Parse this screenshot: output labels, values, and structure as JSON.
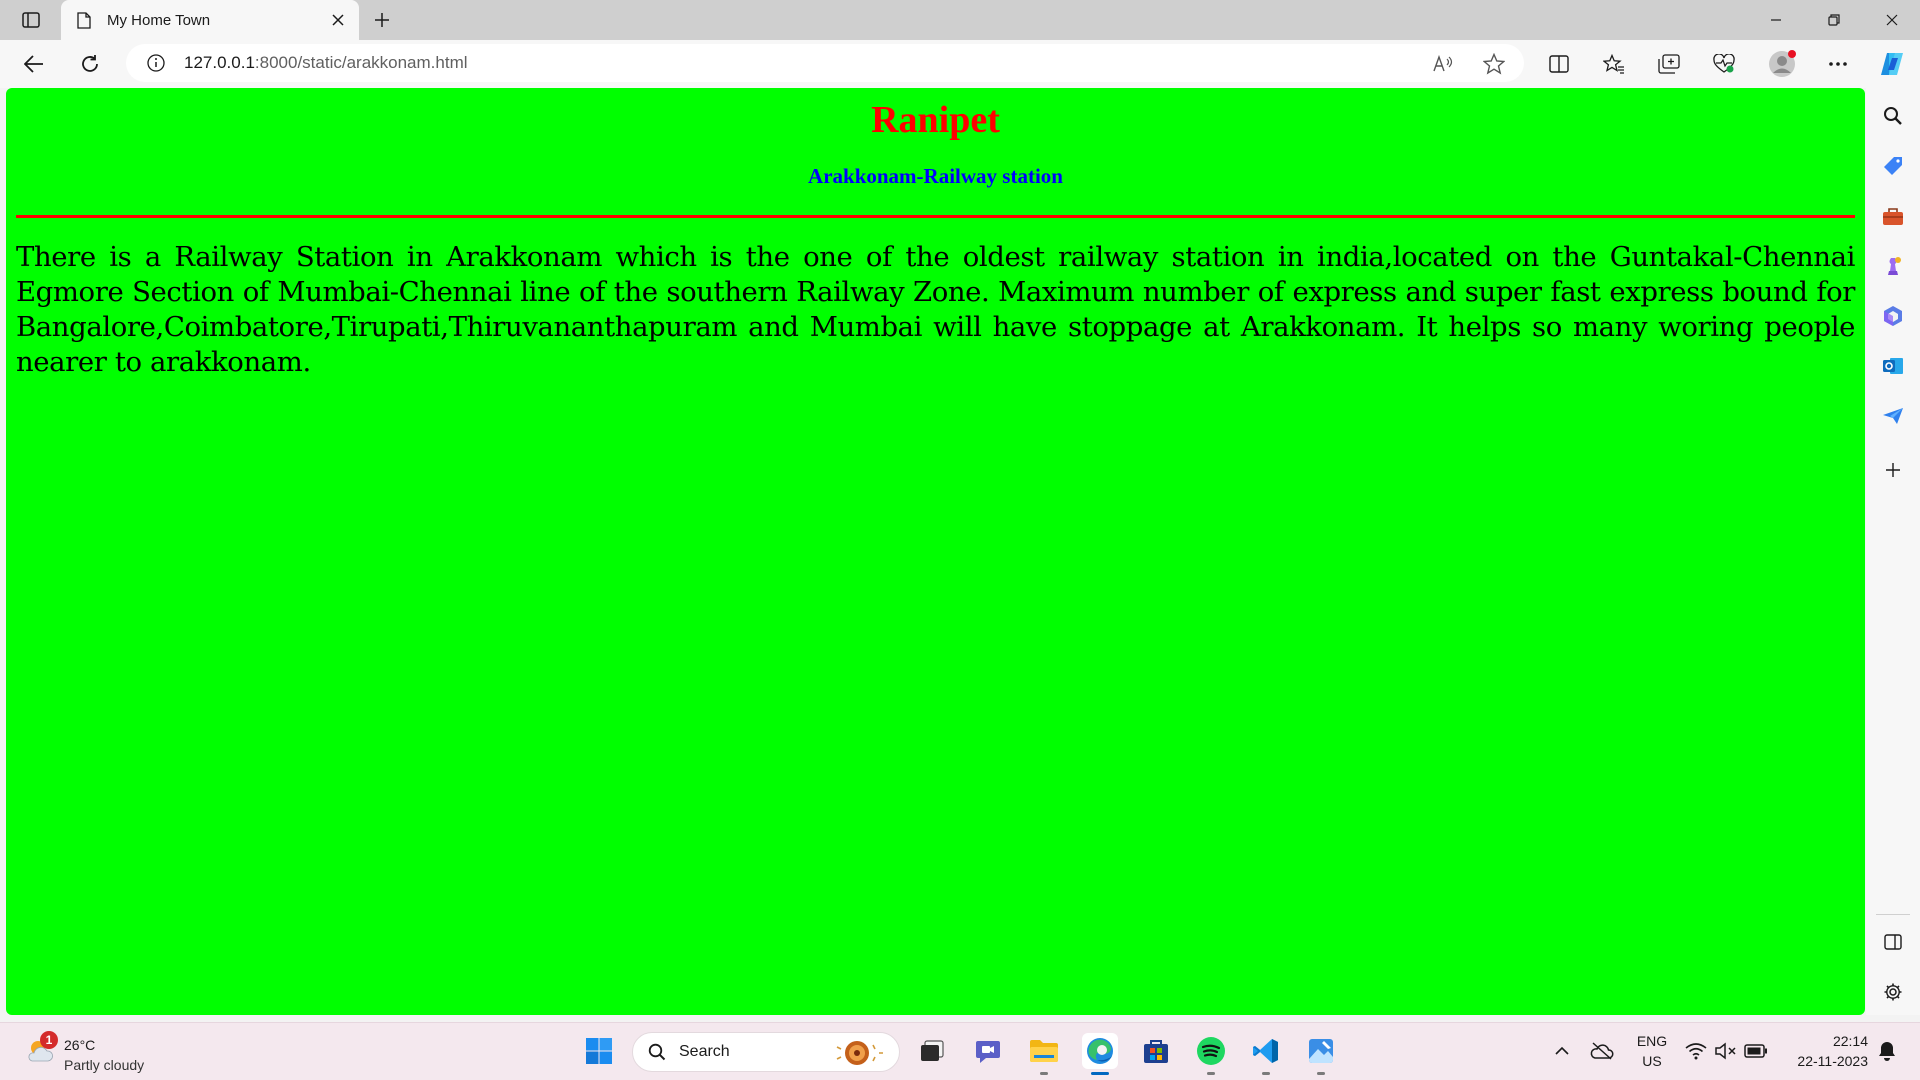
{
  "browser": {
    "tab": {
      "title": "My Home Town"
    },
    "address": {
      "host": "127.0.0.1",
      "path": ":8000/static/arakkonam.html"
    }
  },
  "page": {
    "title": "Ranipet",
    "subtitle": "Arakkonam-Railway station",
    "paragraph": "There is a Railway Station in Arakkonam which is the one of the oldest railway station in india,located on the Guntakal-Chennai Egmore Section of Mumbai-Chennai line of the southern Railway Zone. Maximum number of express and super fast express bound for Bangalore,Coimbatore,Tirupati,Thiruvananthapuram and Mumbai will have stoppage at Arakkonam. It helps so many woring people nearer to arakkonam.",
    "background_color": "#00ff00",
    "title_color": "#ff0000",
    "subtitle_color": "#0000ff",
    "rule_color": "#ff0000"
  },
  "taskbar": {
    "weather": {
      "badge": "1",
      "temp": "26°C",
      "condition": "Partly cloudy"
    },
    "search_label": "Search",
    "lang_line1": "ENG",
    "lang_line2": "US",
    "time": "22:14",
    "date": "22-11-2023"
  }
}
